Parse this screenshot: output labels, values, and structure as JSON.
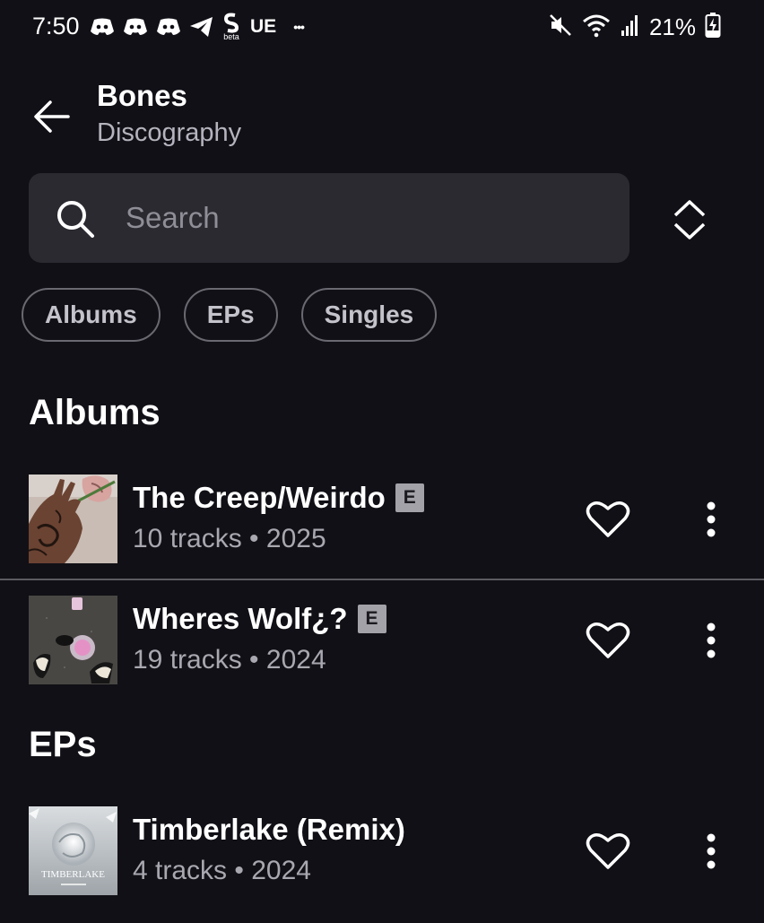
{
  "status_bar": {
    "time": "7:50",
    "carrier_text": "UE",
    "beta_label": "beta",
    "more_indicator": "•••",
    "battery": "21%"
  },
  "header": {
    "title": "Bones",
    "subtitle": "Discography"
  },
  "search": {
    "placeholder": "Search",
    "value": ""
  },
  "filters": [
    {
      "label": "Albums"
    },
    {
      "label": "EPs"
    },
    {
      "label": "Singles"
    }
  ],
  "sections": {
    "albums": {
      "heading": "Albums",
      "items": [
        {
          "title": "The Creep/Weirdo",
          "explicit": "E",
          "meta": "10 tracks • 2025"
        },
        {
          "title": "Wheres Wolf¿?",
          "explicit": "E",
          "meta": "19 tracks • 2024"
        }
      ]
    },
    "eps": {
      "heading": "EPs",
      "items": [
        {
          "title": "Timberlake (Remix)",
          "meta": "4 tracks • 2024",
          "art_text": "TIMBERLAKE"
        }
      ]
    }
  },
  "colors": {
    "background": "#111016",
    "surface": "#2b2a31",
    "text_primary": "#ffffff",
    "text_secondary": "#a9a7b0",
    "explicit_badge": "#a3a2a8"
  },
  "icons": [
    "back-arrow-icon",
    "search-icon",
    "sort-icon",
    "heart-icon",
    "more-vertical-icon",
    "discord-icon",
    "telegram-icon",
    "mute-icon",
    "wifi-icon",
    "signal-icon",
    "battery-charging-icon"
  ]
}
